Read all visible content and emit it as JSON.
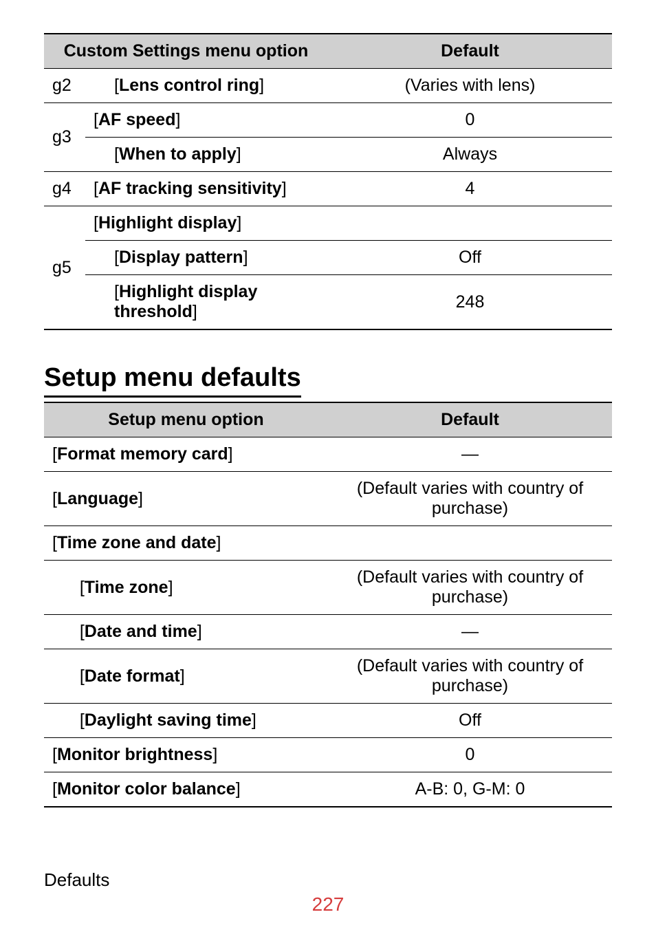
{
  "table1": {
    "header_option": "Custom Settings menu option",
    "header_default": "Default",
    "rows": {
      "g2_label": "g2",
      "g2_opt": "Lens control ring",
      "g2_def": "(Varies with lens)",
      "g3_label": "g3",
      "g3_opt": "AF speed",
      "g3_def": "0",
      "g3_sub_opt": "When to apply",
      "g3_sub_def": "Always",
      "g4_label": "g4",
      "g4_opt": "AF tracking sensitivity",
      "g4_def": "4",
      "g5_label": "g5",
      "g5_head": "Highlight display",
      "g5_sub1_opt": "Display pattern",
      "g5_sub1_def": "Off",
      "g5_sub2_opt": "Highlight display threshold",
      "g5_sub2_def": "248"
    }
  },
  "section_title": "Setup menu defaults",
  "table2": {
    "header_option": "Setup menu option",
    "header_default": "Default",
    "rows": {
      "r1_opt": "Format memory card",
      "r1_def": "—",
      "r2_opt": "Language",
      "r2_def": "(Default varies with country of purchase)",
      "r3_head": "Time zone and date",
      "r3_s1_opt": "Time zone",
      "r3_s1_def": "(Default varies with country of purchase)",
      "r3_s2_opt": "Date and time",
      "r3_s2_def": "—",
      "r3_s3_opt": "Date format",
      "r3_s3_def": "(Default varies with country of purchase)",
      "r3_s4_opt": "Daylight saving time",
      "r3_s4_def": "Off",
      "r4_opt": "Monitor brightness",
      "r4_def": "0",
      "r5_opt": "Monitor color balance",
      "r5_def": "A-B: 0, G-M: 0"
    }
  },
  "footer_label": "Defaults",
  "page_number": "227"
}
